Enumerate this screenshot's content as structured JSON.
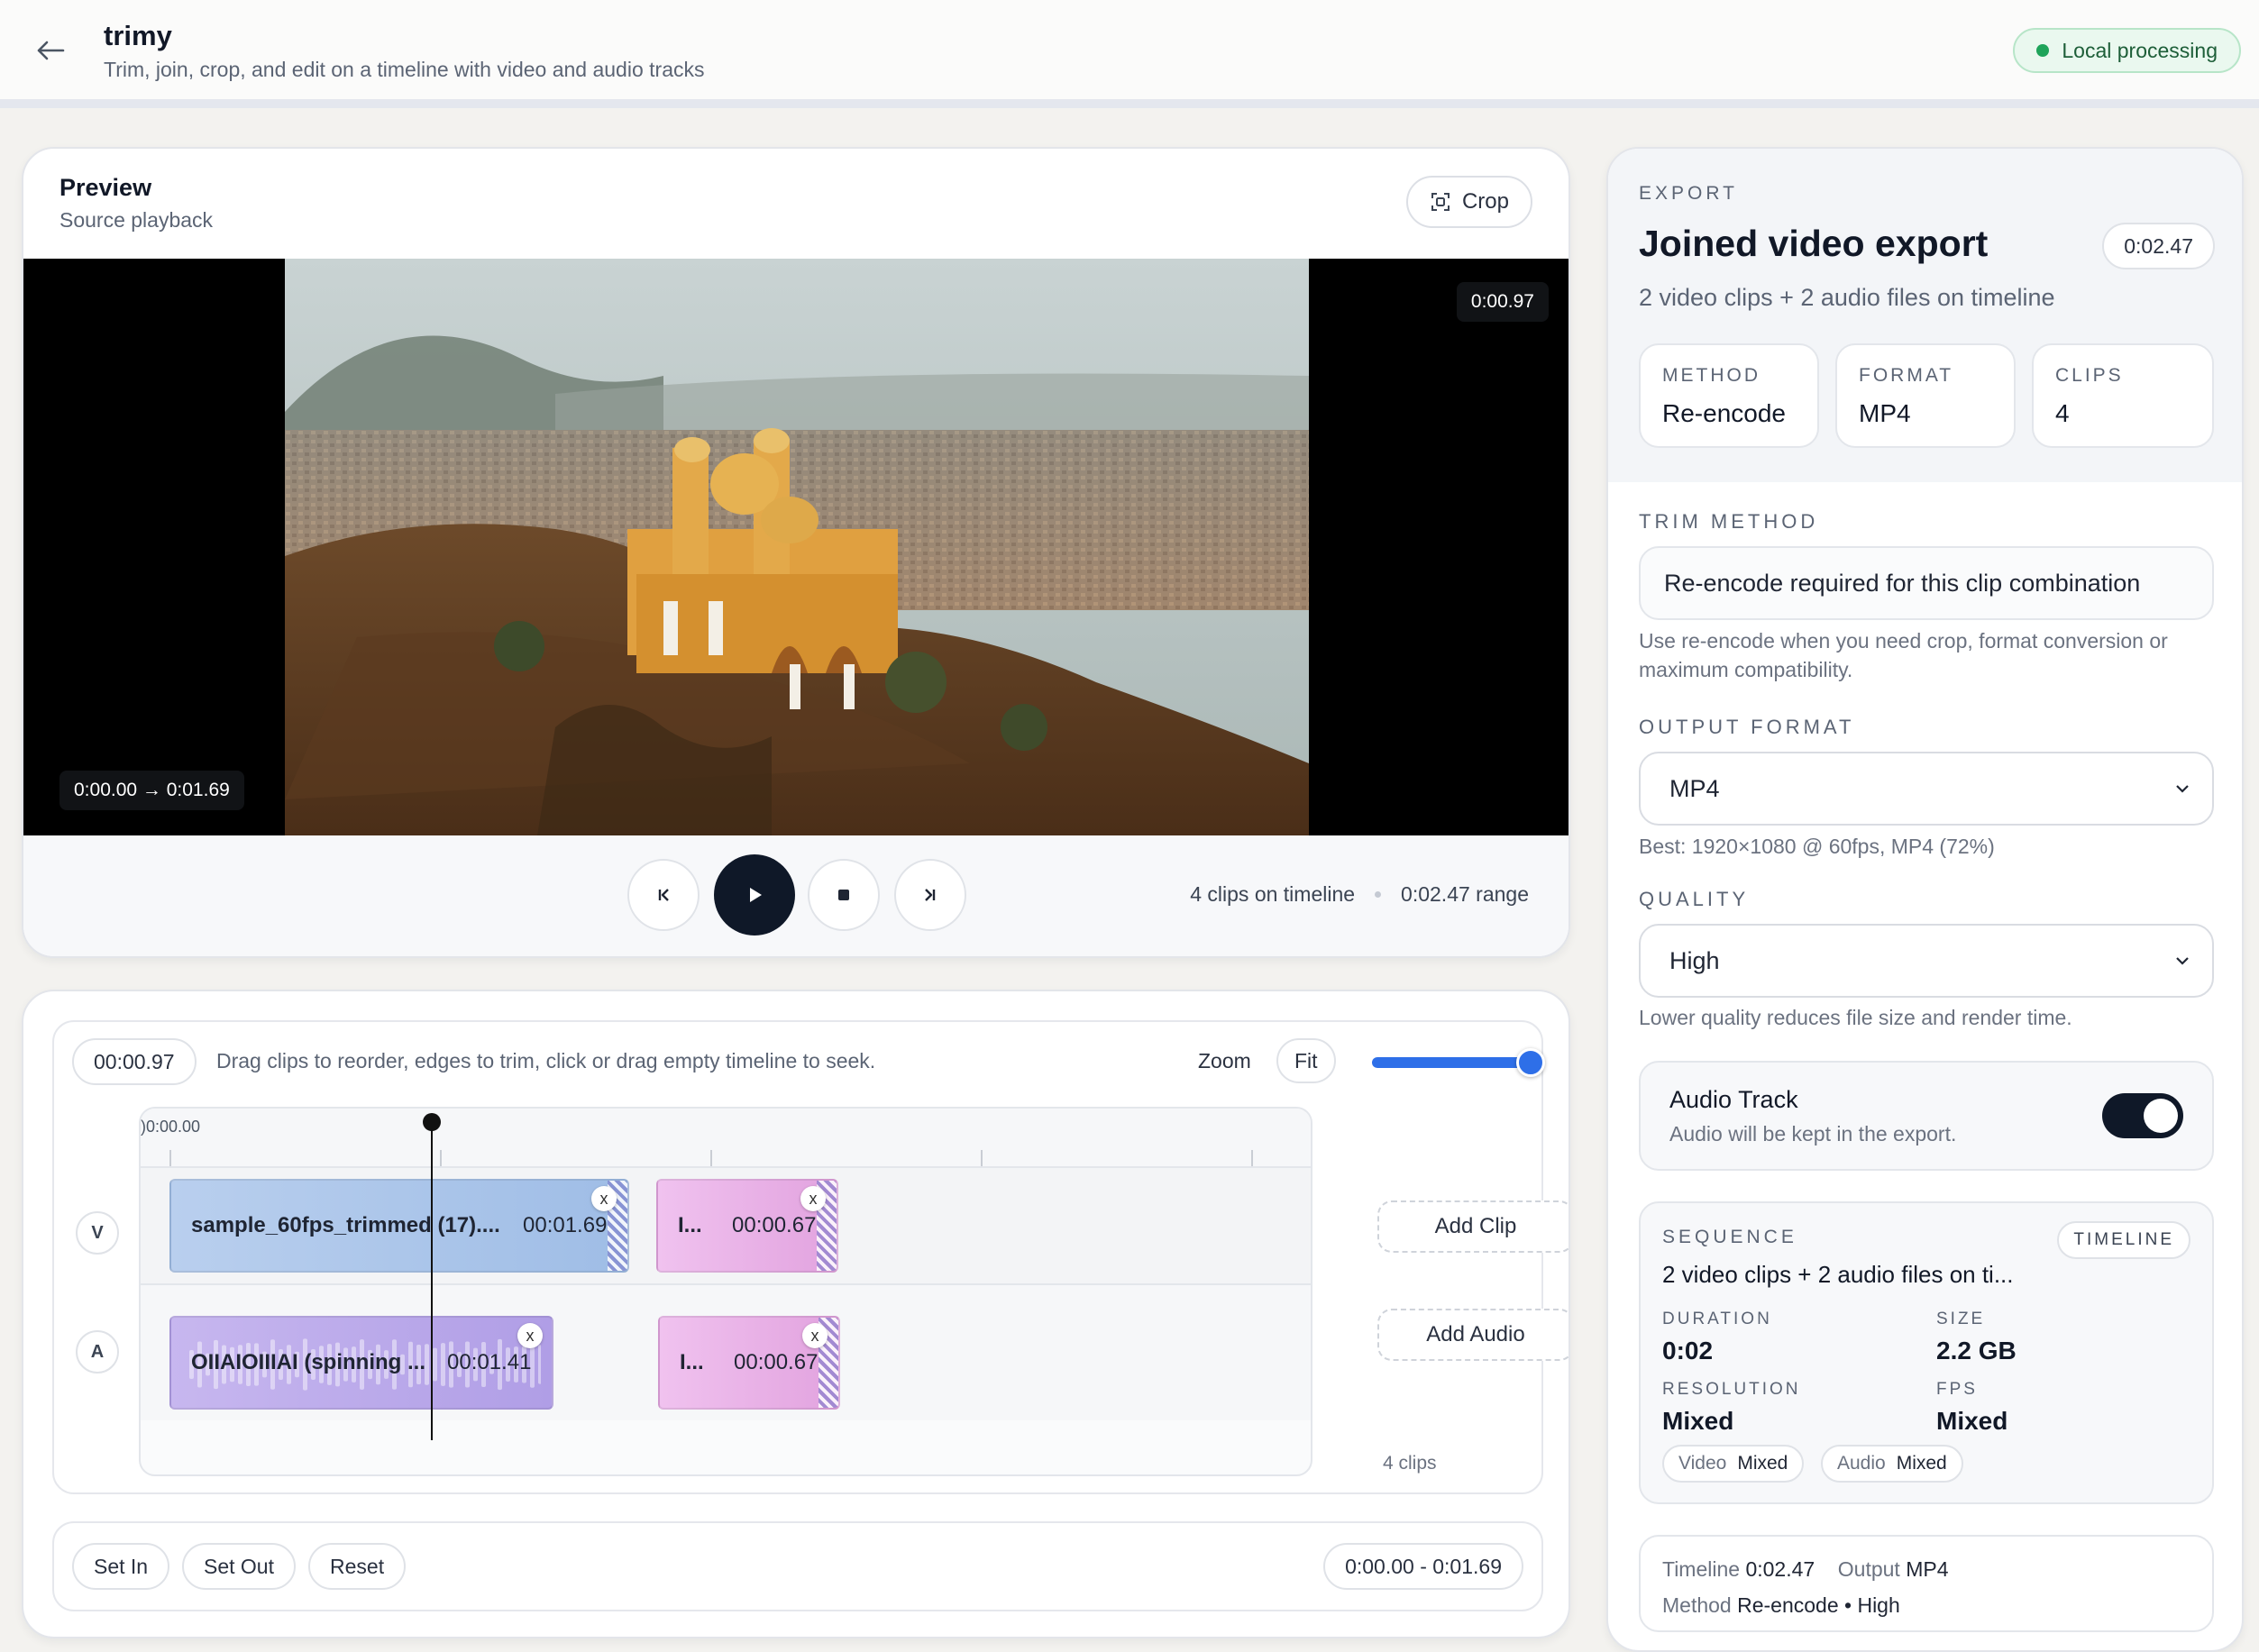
{
  "header": {
    "title": "trimy",
    "subtitle": "Trim, join, crop, and edit on a timeline with video and audio tracks",
    "status": "Local processing"
  },
  "preview": {
    "title": "Preview",
    "subtitle": "Source playback",
    "crop_label": "Crop",
    "current_time": "0:00.97",
    "range": "0:00.00 → 0:01.69",
    "clips_info": "4 clips on timeline",
    "range_info": "0:02.47 range"
  },
  "timeline": {
    "playhead_time": "00:00.97",
    "hint": "Drag clips to reorder, edges to trim, click or drag empty timeline to seek.",
    "zoom_label": "Zoom",
    "fit_label": "Fit",
    "zoom_level": 1.0,
    "ruler_start": ")0:00.00",
    "video_lane_tag": "V",
    "audio_lane_tag": "A",
    "video_clips": [
      {
        "name": "sample_60fps_trimmed (17)....",
        "duration": "00:01.69"
      },
      {
        "name": "I...",
        "duration": "00:00.67"
      }
    ],
    "audio_clips": [
      {
        "name": "OIIAIOIIIAI (spinning ...",
        "duration": "00:01.41"
      },
      {
        "name": "I...",
        "duration": "00:00.67"
      }
    ],
    "remove_label": "x",
    "add_clip": "Add Clip",
    "add_audio": "Add Audio",
    "clip_count": "4 clips",
    "set_in": "Set In",
    "set_out": "Set Out",
    "reset": "Reset",
    "selection": "0:00.00 - 0:01.69"
  },
  "export": {
    "eyebrow": "EXPORT",
    "title": "Joined video export",
    "duration": "0:02.47",
    "subtitle": "2 video clips + 2 audio files on timeline",
    "stats": [
      {
        "label": "METHOD",
        "value": "Re-encode"
      },
      {
        "label": "FORMAT",
        "value": "MP4"
      },
      {
        "label": "CLIPS",
        "value": "4"
      }
    ],
    "trim_method_label": "TRIM METHOD",
    "trim_method_value": "Re-encode required for this clip combination",
    "trim_method_help": "Use re-encode when you need crop, format conversion or maximum compatibility.",
    "output_format_label": "OUTPUT FORMAT",
    "output_format_value": "MP4",
    "output_format_help": "Best: 1920×1080 @ 60fps, MP4 (72%)",
    "quality_label": "QUALITY",
    "quality_value": "High",
    "quality_help": "Lower quality reduces file size and render time.",
    "audio_title": "Audio Track",
    "audio_sub": "Audio will be kept in the export.",
    "audio_enabled": true,
    "sequence_label": "SEQUENCE",
    "sequence_badge": "TIMELINE",
    "sequence_value": "2 video clips + 2 audio files on ti...",
    "duration_label": "DURATION",
    "duration_value": "0:02",
    "size_label": "SIZE",
    "size_value": "2.2 GB",
    "resolution_label": "RESOLUTION",
    "resolution_value": "Mixed",
    "fps_label": "FPS",
    "fps_value": "Mixed",
    "video_tag_key": "Video",
    "video_tag_val": "Mixed",
    "audio_tag_key": "Audio",
    "audio_tag_val": "Mixed",
    "summary_timeline_key": "Timeline",
    "summary_timeline_val": "0:02.47",
    "summary_output_key": "Output",
    "summary_output_val": "MP4",
    "summary_method_key": "Method",
    "summary_method_val": "Re-encode • High"
  },
  "colors": {
    "accent": "#2e6fe8",
    "dark": "#0f1828",
    "success": "#1fa45a"
  }
}
